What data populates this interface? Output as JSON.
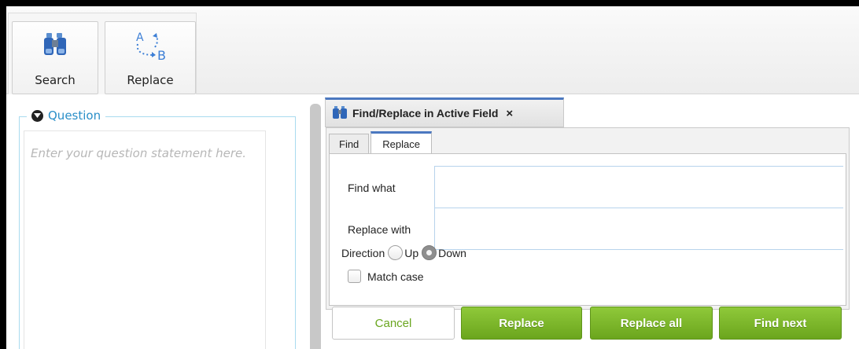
{
  "toolbar": {
    "search_label": "Search",
    "replace_label": "Replace"
  },
  "question": {
    "legend": "Question",
    "placeholder": "Enter your question statement here."
  },
  "dialog": {
    "title": "Find/Replace in Active Field",
    "close": "×",
    "tabs": [
      {
        "label": "Find",
        "active": false
      },
      {
        "label": "Replace",
        "active": true
      }
    ],
    "find_what_label": "Find what",
    "find_what_value": "",
    "replace_with_label": "Replace with",
    "replace_with_value": "",
    "direction_label": "Direction",
    "direction_options": [
      {
        "label": "Up",
        "selected": false
      },
      {
        "label": "Down",
        "selected": true
      }
    ],
    "match_case_label": "Match case",
    "match_case_checked": false
  },
  "buttons": {
    "cancel": "Cancel",
    "replace": "Replace",
    "replace_all": "Replace all",
    "find_next": "Find next"
  },
  "colors": {
    "accent_blue": "#2a8fc8",
    "tab_accent": "#4b78c0",
    "button_green": "#7ab52a",
    "icon_blue": "#3d7fd6"
  },
  "icons": {
    "search": "binoculars-icon",
    "replace": "a-to-b-replace-icon",
    "question_toggle": "chevron-down-circle-icon",
    "dialog": "binoculars-icon",
    "close": "close-icon"
  }
}
